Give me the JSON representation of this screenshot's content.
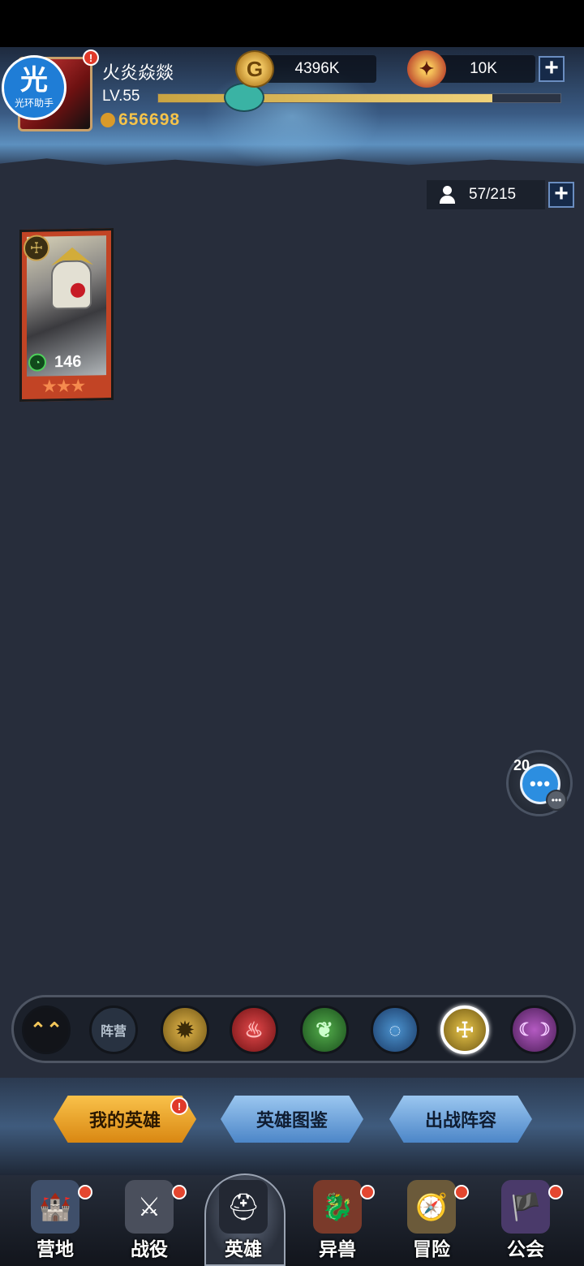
{
  "player": {
    "name": "火炎焱燚",
    "level": "LV.55",
    "xp_fraction": 0.83,
    "power": "656698",
    "alert": "!"
  },
  "helper_badge": {
    "big": "光",
    "small": "光环助手"
  },
  "resources": {
    "gold": "4396K",
    "gold_icon": "G",
    "gems": "10K",
    "gem_icon": "✦",
    "plus": "+"
  },
  "hero_count": {
    "text": "57/215",
    "plus": "+"
  },
  "hero_cards": [
    {
      "faction_icon": "☩",
      "level": "146",
      "stars": "★★★",
      "level_icon": "◔"
    }
  ],
  "chat": {
    "count": "20",
    "dots": "•••",
    "mini": "•••"
  },
  "filters": [
    {
      "label": "⌃⌃"
    },
    {
      "label": "阵营"
    },
    {
      "label": "✹"
    },
    {
      "label": "♨"
    },
    {
      "label": "❦"
    },
    {
      "label": "◌"
    },
    {
      "label": "☩"
    },
    {
      "label": "☾☽"
    }
  ],
  "actions": {
    "my_heroes": "我的英雄",
    "codex": "英雄图鉴",
    "lineup": "出战阵容",
    "alert": "!"
  },
  "nav": [
    {
      "label": "营地",
      "icon": "🏰",
      "dot": true
    },
    {
      "label": "战役",
      "icon": "⚔",
      "dot": true
    },
    {
      "label": "英雄",
      "icon": "⛑",
      "dot": false,
      "active": true
    },
    {
      "label": "异兽",
      "icon": "🐉",
      "dot": true
    },
    {
      "label": "冒险",
      "icon": "🧭",
      "dot": true
    },
    {
      "label": "公会",
      "icon": "🏴",
      "dot": true
    }
  ],
  "colors": {
    "background": "#272d3b",
    "accent_gold": "#f5c34a",
    "alert_red": "#e03a2a",
    "active_filter": "#e8c54a"
  }
}
